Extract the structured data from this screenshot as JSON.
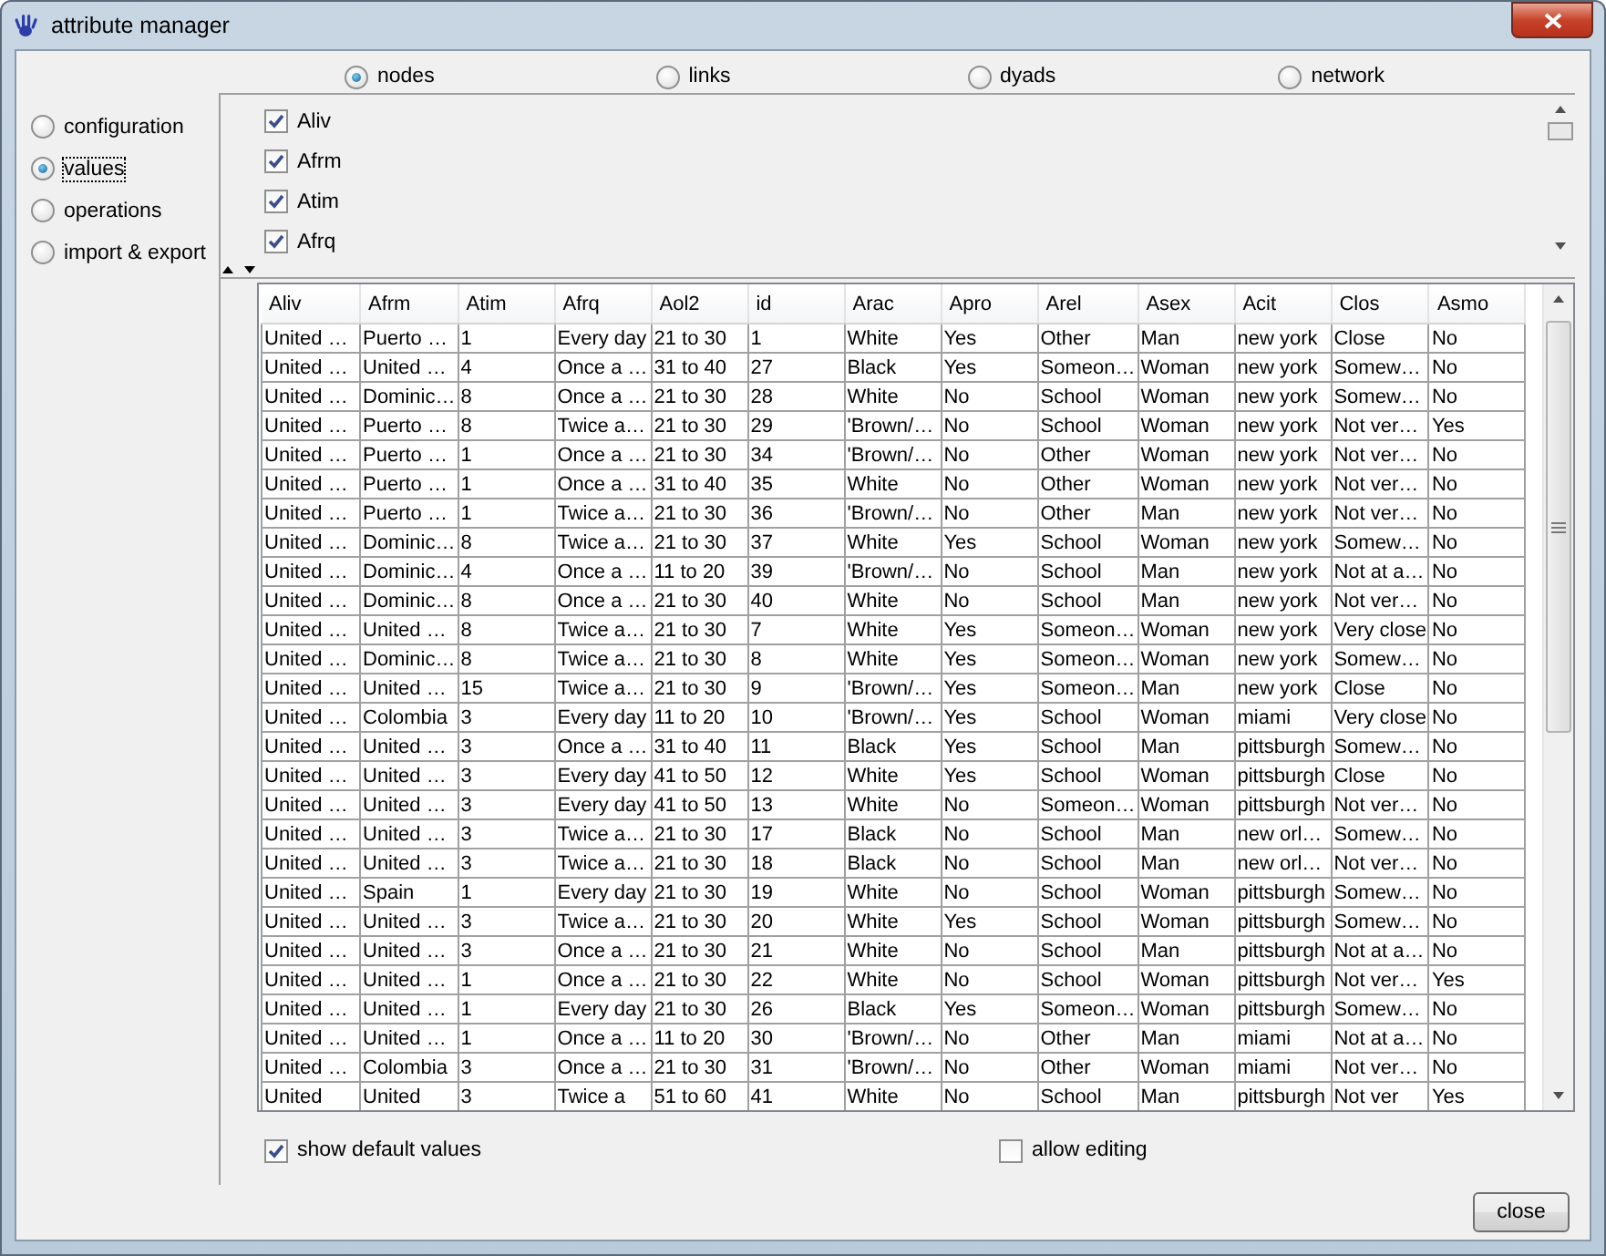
{
  "window": {
    "title": "attribute manager"
  },
  "levels": [
    {
      "label": "nodes",
      "selected": true
    },
    {
      "label": "links",
      "selected": false
    },
    {
      "label": "dyads",
      "selected": false
    },
    {
      "label": "network",
      "selected": false
    }
  ],
  "sidebar": {
    "items": [
      {
        "label": "configuration",
        "selected": false
      },
      {
        "label": "values",
        "selected": true
      },
      {
        "label": "operations",
        "selected": false
      },
      {
        "label": "import & export",
        "selected": false
      }
    ]
  },
  "attributes": [
    {
      "label": "Aliv",
      "checked": true
    },
    {
      "label": "Afrm",
      "checked": true
    },
    {
      "label": "Atim",
      "checked": true
    },
    {
      "label": "Afrq",
      "checked": true
    }
  ],
  "table": {
    "columns": [
      "Aliv",
      "Afrm",
      "Atim",
      "Afrq",
      "Aol2",
      "id",
      "Arac",
      "Apro",
      "Arel",
      "Asex",
      "Acit",
      "Clos",
      "Asmo"
    ],
    "rows": [
      [
        "United …",
        "Puerto …",
        "1",
        "Every day",
        "21 to 30",
        "1",
        "White",
        "Yes",
        "Other",
        "Man",
        "new york",
        "Close",
        "No"
      ],
      [
        "United …",
        "United …",
        "4",
        "Once a …",
        "31 to 40",
        "27",
        "Black",
        "Yes",
        "Someon…",
        "Woman",
        "new york",
        "Somew…",
        "No"
      ],
      [
        "United …",
        "Dominic…",
        "8",
        "Once a …",
        "21 to 30",
        "28",
        "White",
        "No",
        "School",
        "Woman",
        "new york",
        "Somew…",
        "No"
      ],
      [
        "United …",
        "Puerto …",
        "8",
        "Twice a…",
        "21 to 30",
        "29",
        "'Brown/…",
        "No",
        "School",
        "Woman",
        "new york",
        "Not ver…",
        "Yes"
      ],
      [
        "United …",
        "Puerto …",
        "1",
        "Once a …",
        "21 to 30",
        "34",
        "'Brown/…",
        "No",
        "Other",
        "Woman",
        "new york",
        "Not ver…",
        "No"
      ],
      [
        "United …",
        "Puerto …",
        "1",
        "Once a …",
        "31 to 40",
        "35",
        "White",
        "No",
        "Other",
        "Woman",
        "new york",
        "Not ver…",
        "No"
      ],
      [
        "United …",
        "Puerto …",
        "1",
        "Twice a…",
        "21 to 30",
        "36",
        "'Brown/…",
        "No",
        "Other",
        "Man",
        "new york",
        "Not ver…",
        "No"
      ],
      [
        "United …",
        "Dominic…",
        "8",
        "Twice a…",
        "21 to 30",
        "37",
        "White",
        "Yes",
        "School",
        "Woman",
        "new york",
        "Somew…",
        "No"
      ],
      [
        "United …",
        "Dominic…",
        "4",
        "Once a …",
        "11 to 20",
        "39",
        "'Brown/…",
        "No",
        "School",
        "Man",
        "new york",
        "Not at a…",
        "No"
      ],
      [
        "United …",
        "Dominic…",
        "8",
        "Once a …",
        "21 to 30",
        "40",
        "White",
        "No",
        "School",
        "Man",
        "new york",
        "Not ver…",
        "No"
      ],
      [
        "United …",
        "United …",
        "8",
        "Twice a…",
        "21 to 30",
        "7",
        "White",
        "Yes",
        "Someon…",
        "Woman",
        "new york",
        "Very close",
        "No"
      ],
      [
        "United …",
        "Dominic…",
        "8",
        "Twice a…",
        "21 to 30",
        "8",
        "White",
        "Yes",
        "Someon…",
        "Woman",
        "new york",
        "Somew…",
        "No"
      ],
      [
        "United …",
        "United …",
        "15",
        "Twice a…",
        "21 to 30",
        "9",
        "'Brown/…",
        "Yes",
        "Someon…",
        "Man",
        "new york",
        "Close",
        "No"
      ],
      [
        "United …",
        "Colombia",
        "3",
        "Every day",
        "11 to 20",
        "10",
        "'Brown/…",
        "Yes",
        "School",
        "Woman",
        "miami",
        "Very close",
        "No"
      ],
      [
        "United …",
        "United …",
        "3",
        "Once a …",
        "31 to 40",
        "11",
        "Black",
        "Yes",
        "School",
        "Man",
        "pittsburgh",
        "Somew…",
        "No"
      ],
      [
        "United …",
        "United …",
        "3",
        "Every day",
        "41 to 50",
        "12",
        "White",
        "Yes",
        "School",
        "Woman",
        "pittsburgh",
        "Close",
        "No"
      ],
      [
        "United …",
        "United …",
        "3",
        "Every day",
        "41 to 50",
        "13",
        "White",
        "No",
        "Someon…",
        "Woman",
        "pittsburgh",
        "Not ver…",
        "No"
      ],
      [
        "United …",
        "United …",
        "3",
        "Twice a…",
        "21 to 30",
        "17",
        "Black",
        "No",
        "School",
        "Man",
        "new orl…",
        "Somew…",
        "No"
      ],
      [
        "United …",
        "United …",
        "3",
        "Twice a…",
        "21 to 30",
        "18",
        "Black",
        "No",
        "School",
        "Man",
        "new orl…",
        "Not ver…",
        "No"
      ],
      [
        "United …",
        "Spain",
        "1",
        "Every day",
        "21 to 30",
        "19",
        "White",
        "No",
        "School",
        "Woman",
        "pittsburgh",
        "Somew…",
        "No"
      ],
      [
        "United …",
        "United …",
        "3",
        "Twice a…",
        "21 to 30",
        "20",
        "White",
        "Yes",
        "School",
        "Woman",
        "pittsburgh",
        "Somew…",
        "No"
      ],
      [
        "United …",
        "United …",
        "3",
        "Once a …",
        "21 to 30",
        "21",
        "White",
        "No",
        "School",
        "Man",
        "pittsburgh",
        "Not at a…",
        "No"
      ],
      [
        "United …",
        "United …",
        "1",
        "Once a …",
        "21 to 30",
        "22",
        "White",
        "No",
        "School",
        "Woman",
        "pittsburgh",
        "Not ver…",
        "Yes"
      ],
      [
        "United …",
        "United …",
        "1",
        "Every day",
        "21 to 30",
        "26",
        "Black",
        "Yes",
        "Someon…",
        "Woman",
        "pittsburgh",
        "Somew…",
        "No"
      ],
      [
        "United …",
        "United …",
        "1",
        "Once a …",
        "11 to 20",
        "30",
        "'Brown/…",
        "No",
        "Other",
        "Man",
        "miami",
        "Not at a…",
        "No"
      ],
      [
        "United …",
        "Colombia",
        "3",
        "Once a …",
        "21 to 30",
        "31",
        "'Brown/…",
        "No",
        "Other",
        "Woman",
        "miami",
        "Not ver…",
        "No"
      ],
      [
        "United",
        "United",
        "3",
        "Twice a",
        "51 to 60",
        "41",
        "White",
        "No",
        "School",
        "Man",
        "pittsburgh",
        "Not ver",
        "Yes"
      ]
    ]
  },
  "options": [
    {
      "label": "show default values",
      "checked": true
    },
    {
      "label": "allow editing",
      "checked": false
    }
  ],
  "buttons": [
    "close"
  ]
}
